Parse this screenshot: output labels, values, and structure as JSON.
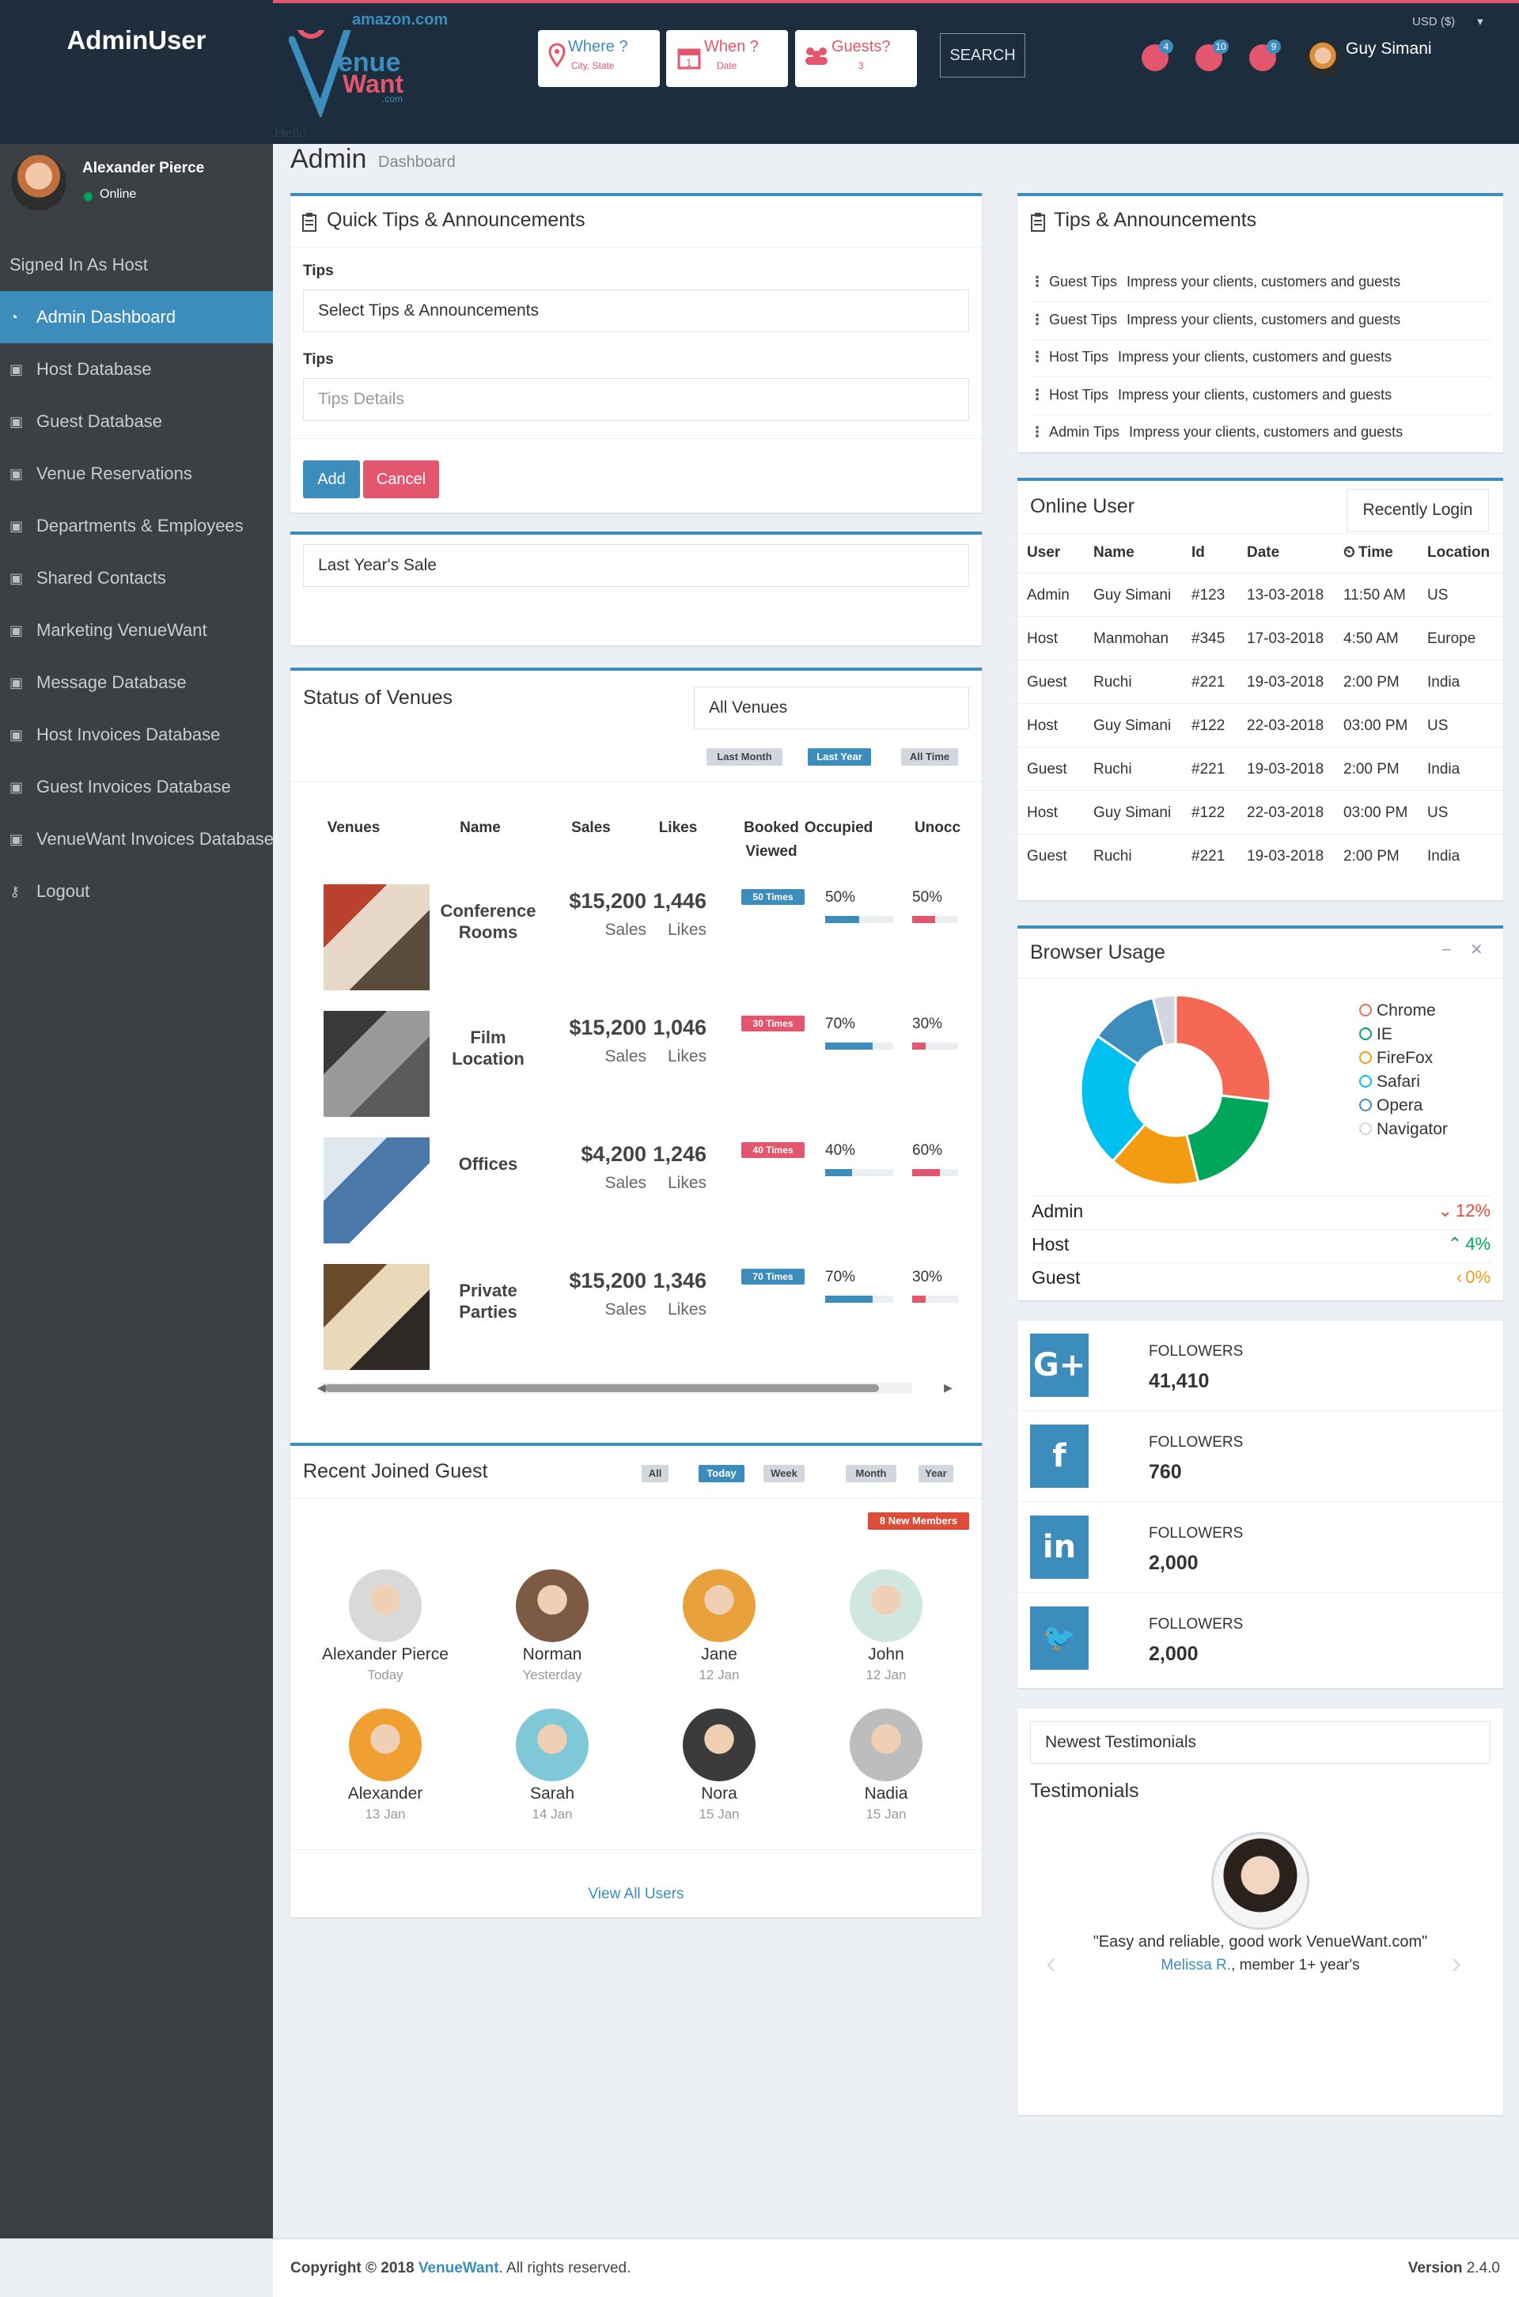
{
  "brand": {
    "admin_title": "AdminUser",
    "amazon": "amazon.com",
    "logo_venue": "enue",
    "logo_want": "Want",
    "logo_com": ".com",
    "hello": "Hello"
  },
  "search": {
    "where_label": "Where ?",
    "where_sub": "City, State",
    "when_label": "When ?",
    "when_sub": "Date",
    "guests_label": "Guests?",
    "guests_sub": "3",
    "button": "SEARCH"
  },
  "topbar": {
    "currency": "USD ($)",
    "badges": [
      "4",
      "10",
      "9"
    ],
    "user_name": "Guy Simani"
  },
  "sidebar": {
    "user_name": "Alexander Pierce",
    "status": "Online",
    "signed_in": "Signed In As Host",
    "items": [
      {
        "label": "Admin Dashboard",
        "icon": "dashboard-icon",
        "active": true
      },
      {
        "label": "Host Database",
        "icon": "calendar-check-icon"
      },
      {
        "label": "Guest Database",
        "icon": "calendar-check-icon"
      },
      {
        "label": "Venue Reservations",
        "icon": "calendar-check-icon"
      },
      {
        "label": "Departments & Employees",
        "icon": "calendar-check-icon"
      },
      {
        "label": "Shared Contacts",
        "icon": "calendar-check-icon"
      },
      {
        "label": "Marketing VenueWant",
        "icon": "calendar-check-icon"
      },
      {
        "label": "Message Database",
        "icon": "calendar-check-icon"
      },
      {
        "label": "Host Invoices Database",
        "icon": "calendar-check-icon"
      },
      {
        "label": "Guest Invoices Database",
        "icon": "calendar-check-icon"
      },
      {
        "label": "VenueWant Invoices Database",
        "icon": "calendar-check-icon"
      },
      {
        "label": "Logout",
        "icon": "key-icon"
      }
    ]
  },
  "header": {
    "title": "Admin",
    "subtitle": "Dashboard"
  },
  "quick_tips": {
    "title": "Quick Tips & Announcements",
    "tips_label": "Tips",
    "select_value": "Select Tips & Announcements",
    "details_label": "Tips",
    "details_placeholder": "Tips Details",
    "add": "Add",
    "cancel": "Cancel"
  },
  "last_year": {
    "label": "Last Year's Sale"
  },
  "tips_announcements": {
    "title": "Tips & Announcements",
    "items": [
      {
        "tag": "Guest Tips",
        "text": "Impress your clients, customers and guests"
      },
      {
        "tag": "Guest Tips",
        "text": "Impress your clients, customers and guests"
      },
      {
        "tag": "Host Tips",
        "text": "Impress your clients, customers and guests"
      },
      {
        "tag": "Host Tips",
        "text": "Impress your clients, customers and guests"
      },
      {
        "tag": "Admin Tips",
        "text": "Impress your clients, customers and guests"
      }
    ]
  },
  "online_user": {
    "title": "Online User",
    "tab": "Recently Login",
    "headers": [
      "User",
      "Name",
      "Id",
      "Date",
      "Time",
      "Location"
    ],
    "rows": [
      [
        "Admin",
        "Guy Simani",
        "#123",
        "13-03-2018",
        "11:50 AM",
        "US"
      ],
      [
        "Host",
        "Manmohan",
        "#345",
        "17-03-2018",
        "4:50 AM",
        "Europe"
      ],
      [
        "Guest",
        "Ruchi",
        "#221",
        "19-03-2018",
        "2:00 PM",
        "India"
      ],
      [
        "Host",
        "Guy Simani",
        "#122",
        "22-03-2018",
        "03:00 PM",
        "US"
      ],
      [
        "Guest",
        "Ruchi",
        "#221",
        "19-03-2018",
        "2:00 PM",
        "India"
      ],
      [
        "Host",
        "Guy Simani",
        "#122",
        "22-03-2018",
        "03:00 PM",
        "US"
      ],
      [
        "Guest",
        "Ruchi",
        "#221",
        "19-03-2018",
        "2:00 PM",
        "India"
      ]
    ]
  },
  "venues": {
    "title": "Status of Venues",
    "filter": "All Venues",
    "periods": [
      "Last Month",
      "Last Year",
      "All Time"
    ],
    "headers": [
      "Venues",
      "Name",
      "Sales",
      "Likes",
      "Booked Viewed",
      "Occupied",
      "Unocc"
    ],
    "rows": [
      {
        "name": "Conference Rooms",
        "sales": "$15,200",
        "sales_label": "Sales",
        "likes": "1,446",
        "likes_label": "Likes",
        "booked": "50 Times",
        "booked_color": "#3c8dbc",
        "occupied": "50%",
        "occupied_value": 0.5,
        "unocc": "50%",
        "unocc_value": 0.5,
        "photo_colors": [
          "#b9412d",
          "#e8d8c8",
          "#5a4a3a"
        ]
      },
      {
        "name": "Film Location",
        "sales": "$15,200",
        "sales_label": "Sales",
        "likes": "1,046",
        "likes_label": "Likes",
        "booked": "30 Times",
        "booked_color": "#e4556e",
        "occupied": "70%",
        "occupied_value": 0.7,
        "unocc": "30%",
        "unocc_value": 0.3,
        "photo_colors": [
          "#3a3a3a",
          "#9a9a9a",
          "#5a5a5a"
        ]
      },
      {
        "name": "Offices",
        "sales": "$4,200",
        "sales_label": "Sales",
        "likes": "1,246",
        "likes_label": "Likes",
        "booked": "40 Times",
        "booked_color": "#e4556e",
        "occupied": "40%",
        "occupied_value": 0.4,
        "unocc": "60%",
        "unocc_value": 0.6,
        "photo_colors": [
          "#dfe8ef",
          "#4a78a8",
          "#ffffff"
        ]
      },
      {
        "name": "Private Parties",
        "sales": "$15,200",
        "sales_label": "Sales",
        "likes": "1,346",
        "likes_label": "Likes",
        "booked": "70 Times",
        "booked_color": "#3c8dbc",
        "occupied": "70%",
        "occupied_value": 0.7,
        "unocc": "30%",
        "unocc_value": 0.3,
        "photo_colors": [
          "#6b4a2c",
          "#e9d9b8",
          "#2f2a26"
        ]
      }
    ]
  },
  "browser_usage": {
    "title": "Browser Usage",
    "legend": [
      {
        "name": "Chrome",
        "color": "#f56954"
      },
      {
        "name": "IE",
        "color": "#00a65a"
      },
      {
        "name": "FireFox",
        "color": "#f39c12"
      },
      {
        "name": "Safari",
        "color": "#00c0ef"
      },
      {
        "name": "Opera",
        "color": "#3c8dbc"
      },
      {
        "name": "Navigator",
        "color": "#d2d6de"
      }
    ],
    "stats": [
      {
        "label": "Admin",
        "value": "12%",
        "dir": "down",
        "color": "#dd4b39"
      },
      {
        "label": "Host",
        "value": "4%",
        "dir": "up",
        "color": "#00a65a"
      },
      {
        "label": "Guest",
        "value": "0%",
        "dir": "left",
        "color": "#f39c12"
      }
    ]
  },
  "chart_data": {
    "type": "pie",
    "categories": [
      "Chrome",
      "IE",
      "FireFox",
      "Safari",
      "Opera",
      "Navigator"
    ],
    "values": [
      700,
      500,
      400,
      600,
      300,
      100
    ],
    "colors": [
      "#f56954",
      "#00a65a",
      "#f39c12",
      "#00c0ef",
      "#3c8dbc",
      "#d2d6de"
    ],
    "title": "Browser Usage"
  },
  "social": [
    {
      "label": "FOLLOWERS",
      "count": "41,410",
      "icon": "google-plus-icon",
      "glyph": "G+",
      "color": "#3c8dbc"
    },
    {
      "label": "FOLLOWERS",
      "count": "760",
      "icon": "facebook-icon",
      "glyph": "f",
      "color": "#3c8dbc"
    },
    {
      "label": "FOLLOWERS",
      "count": "2,000",
      "icon": "linkedin-icon",
      "glyph": "in",
      "color": "#3c8dbc"
    },
    {
      "label": "FOLLOWERS",
      "count": "2,000",
      "icon": "twitter-icon",
      "glyph": "🐦",
      "color": "#3c8dbc"
    }
  ],
  "guests": {
    "title": "Recent Joined Guest",
    "periods": [
      "All",
      "Today",
      "Week",
      "Month",
      "Year"
    ],
    "badge": "8 New Members",
    "members": [
      {
        "name": "Alexander Pierce",
        "date": "Today",
        "color": "#d9d9d9"
      },
      {
        "name": "Norman",
        "date": "Yesterday",
        "color": "#7d5a43"
      },
      {
        "name": "Jane",
        "date": "12 Jan",
        "color": "#e9a23b"
      },
      {
        "name": "John",
        "date": "12 Jan",
        "color": "#cfe7e0"
      },
      {
        "name": "Alexander",
        "date": "13 Jan",
        "color": "#f0a030"
      },
      {
        "name": "Sarah",
        "date": "14 Jan",
        "color": "#7ec8d8"
      },
      {
        "name": "Nora",
        "date": "15 Jan",
        "color": "#3b3b3b"
      },
      {
        "name": "Nadia",
        "date": "15 Jan",
        "color": "#bdbdbd"
      }
    ],
    "view_all": "View All Users"
  },
  "testimonials": {
    "tab": "Newest Testimonials",
    "title": "Testimonials",
    "quote": "\"Easy and reliable, good work VenueWant.com\"",
    "author": "Melissa R.",
    "author_suffix": ", member 1+ year's"
  },
  "footer": {
    "copyright": "Copyright © 2018 ",
    "brand": "VenueWant",
    "rights": ". All rights reserved.",
    "version_label": "Version",
    "version": "2.4.0"
  }
}
